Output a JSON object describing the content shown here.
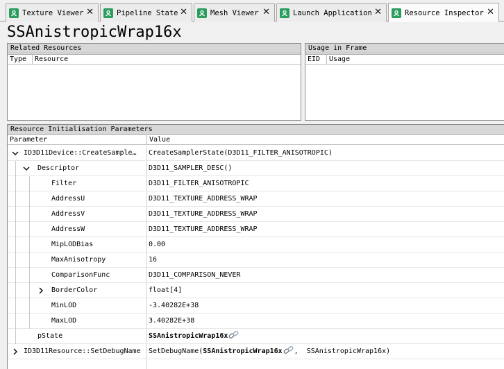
{
  "tabs": [
    {
      "label": "Texture Viewer",
      "close": "✕",
      "active": false
    },
    {
      "label": "Pipeline State",
      "close": "✕",
      "active": false
    },
    {
      "label": "Mesh Viewer",
      "close": "✕",
      "active": false
    },
    {
      "label": "Launch Application",
      "close": "✕",
      "active": false
    },
    {
      "label": "Resource Inspector",
      "close": "✕",
      "active": true
    }
  ],
  "accent_color": "#2a9d5d",
  "resource_name": "SSAnistropicWrap16x",
  "related_resources": {
    "title": "Related Resources",
    "columns": [
      "Type",
      "Resource"
    ]
  },
  "usage_in_frame": {
    "title": "Usage in Frame",
    "columns": [
      "EID",
      "Usage"
    ]
  },
  "init_params": {
    "title": "Resource Initialisation Parameters",
    "columns": [
      "Parameter",
      "Value"
    ],
    "rows": [
      {
        "name": "ID3D11Device::CreateSample…",
        "value": "CreateSamplerState(D3D11_FILTER_ANISOTROPIC)",
        "expander": "expanded"
      },
      {
        "name": "Descriptor",
        "value": "D3D11_SAMPLER_DESC()",
        "expander": "expanded"
      },
      {
        "name": "Filter",
        "value": "D3D11_FILTER_ANISOTROPIC",
        "expander": "none"
      },
      {
        "name": "AddressU",
        "value": "D3D11_TEXTURE_ADDRESS_WRAP",
        "expander": "none"
      },
      {
        "name": "AddressV",
        "value": "D3D11_TEXTURE_ADDRESS_WRAP",
        "expander": "none"
      },
      {
        "name": "AddressW",
        "value": "D3D11_TEXTURE_ADDRESS_WRAP",
        "expander": "none"
      },
      {
        "name": "MipLODBias",
        "value": "0.00",
        "expander": "none"
      },
      {
        "name": "MaxAnisotropy",
        "value": "16",
        "expander": "none"
      },
      {
        "name": "ComparisonFunc",
        "value": "D3D11_COMPARISON_NEVER",
        "expander": "none"
      },
      {
        "name": "BorderColor",
        "value": "float[4]",
        "expander": "collapsed"
      },
      {
        "name": "MinLOD",
        "value": "-3.40282E+38",
        "expander": "none"
      },
      {
        "name": "MaxLOD",
        "value": "3.40282E+38",
        "expander": "none"
      },
      {
        "name": "pState",
        "value_link": "SSAnistropicWrap16x",
        "expander": "none"
      },
      {
        "name": "ID3D11Resource::SetDebugName",
        "value_prefix": "SetDebugName(",
        "value_link": "SSAnistropicWrap16x",
        "value_suffix": ",  SSAnistropicWrap16x)",
        "expander": "collapsed"
      }
    ]
  }
}
